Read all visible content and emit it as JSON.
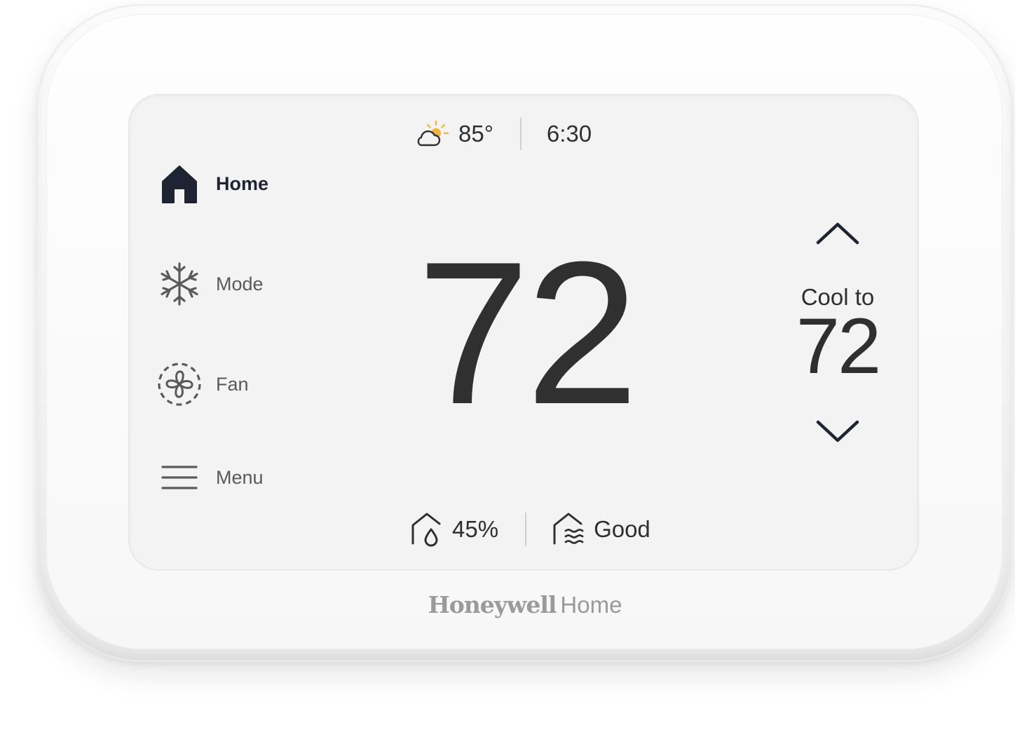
{
  "device": {
    "brand_primary": "Honeywell",
    "brand_secondary": "Home"
  },
  "status_top": {
    "weather_icon": "partly-cloudy-sun-icon",
    "outdoor_temp": "85°",
    "time": "6:30"
  },
  "nav": {
    "items": [
      {
        "label": "Home",
        "icon": "house-icon",
        "active": true
      },
      {
        "label": "Mode",
        "icon": "snowflake-icon",
        "active": false
      },
      {
        "label": "Fan",
        "icon": "fan-icon",
        "active": false
      },
      {
        "label": "Menu",
        "icon": "hamburger-menu-icon",
        "active": false
      }
    ]
  },
  "main": {
    "current_temp": "72"
  },
  "setpoint": {
    "label": "Cool to",
    "value": "72",
    "up_icon": "chevron-up-icon",
    "down_icon": "chevron-down-icon"
  },
  "status_bottom": {
    "humidity_icon": "home-humidity-icon",
    "humidity": "45%",
    "air_quality_icon": "home-air-quality-icon",
    "air_quality": "Good"
  },
  "colors": {
    "screen_bg": "#f3f3f3",
    "text_dark": "#2f2f2f",
    "nav_active": "#1f2433",
    "nav_inactive": "#5a5a5a",
    "sun_accent": "#f0b43c",
    "brand_gray": "#9a9a9a"
  }
}
